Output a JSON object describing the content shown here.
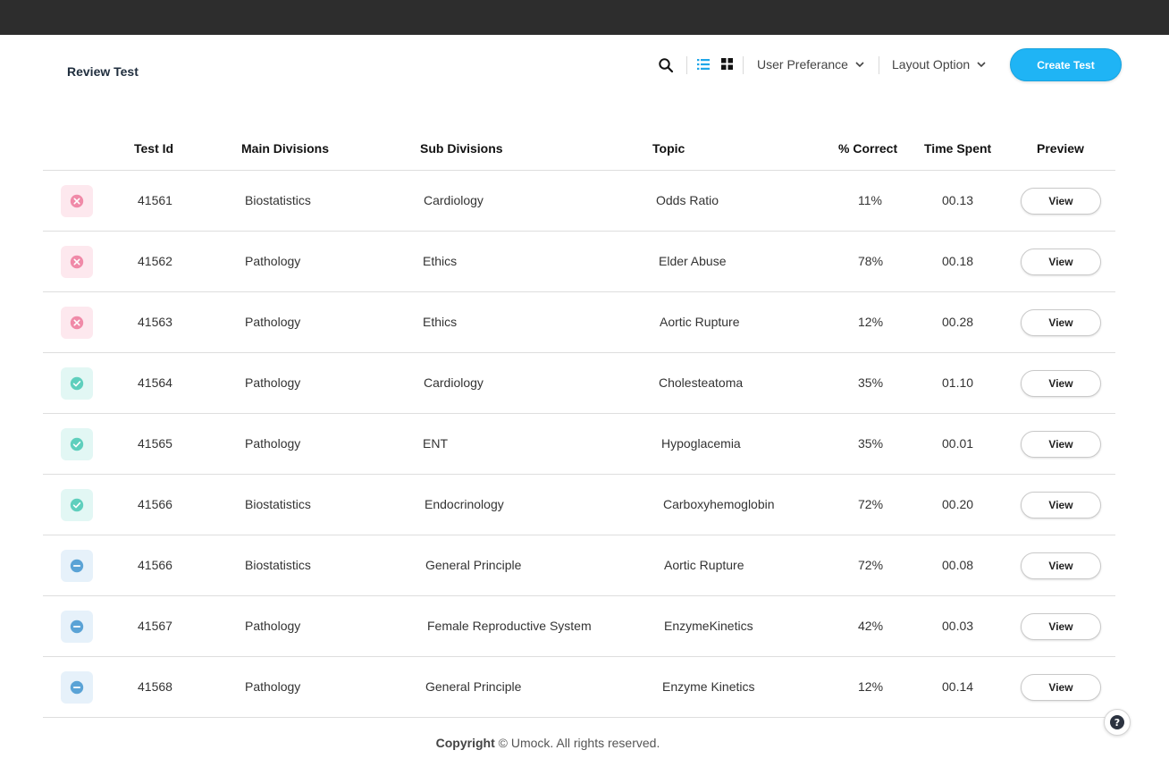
{
  "page": {
    "title": "Review Test"
  },
  "toolbar": {
    "search_icon": "search-icon",
    "list_view_icon": "list-view-icon",
    "grid_view_icon": "grid-view-icon",
    "user_preference_label": "User Preferance",
    "layout_option_label": "Layout Option",
    "create_button_label": "Create Test",
    "accent_color": "#1fb4f5"
  },
  "table": {
    "headers": [
      "Test Id",
      "Main Divisions",
      "Sub Divisions",
      "Topic",
      "% Correct",
      "Time Spent",
      "Preview"
    ],
    "rows": [
      {
        "status": "fail",
        "id": "41561",
        "main": "Biostatistics",
        "sub": "Cardiology",
        "topic": "Odds Ratio",
        "pct": "11%",
        "time": "00.13",
        "action": "View"
      },
      {
        "status": "fail",
        "id": "41562",
        "main": "Pathology",
        "sub": "Ethics",
        "topic": "Elder Abuse",
        "pct": "78%",
        "time": "00.18",
        "action": "View"
      },
      {
        "status": "fail",
        "id": "41563",
        "main": "Pathology",
        "sub": "Ethics",
        "topic": "Aortic Rupture",
        "pct": "12%",
        "time": "00.28",
        "action": "View"
      },
      {
        "status": "pass",
        "id": "41564",
        "main": "Pathology",
        "sub": "Cardiology",
        "topic": "Cholesteatoma",
        "pct": "35%",
        "time": "01.10",
        "action": "View"
      },
      {
        "status": "pass",
        "id": "41565",
        "main": "Pathology",
        "sub": "ENT",
        "topic": "Hypoglacemia",
        "pct": "35%",
        "time": "00.01",
        "action": "View"
      },
      {
        "status": "pass",
        "id": "41566",
        "main": "Biostatistics",
        "sub": "Endocrinology",
        "topic": "Carboxyhemoglobin",
        "pct": "72%",
        "time": "00.20",
        "action": "View"
      },
      {
        "status": "neutral",
        "id": "41566",
        "main": "Biostatistics",
        "sub": "General Principle",
        "topic": "Aortic Rupture",
        "pct": "72%",
        "time": "00.08",
        "action": "View"
      },
      {
        "status": "neutral",
        "id": "41567",
        "main": "Pathology",
        "sub": "Female Reproductive System",
        "topic": "EnzymeKinetics",
        "pct": "42%",
        "time": "00.03",
        "action": "View"
      },
      {
        "status": "neutral",
        "id": "41568",
        "main": "Pathology",
        "sub": "General Principle",
        "topic": "Enzyme Kinetics",
        "pct": "12%",
        "time": "00.14",
        "action": "View"
      }
    ],
    "status_colors": {
      "fail": "#f08aa8",
      "pass": "#5fcfbd",
      "neutral": "#5aa3d6"
    },
    "status_icons": {
      "fail": "x-circle-icon",
      "pass": "check-circle-icon",
      "neutral": "minus-circle-icon"
    }
  },
  "footer": {
    "copyright_bold": "Copyright",
    "copyright_rest": "© Umock. All rights reserved.",
    "help_icon": "help-icon",
    "help_glyph": "?"
  }
}
